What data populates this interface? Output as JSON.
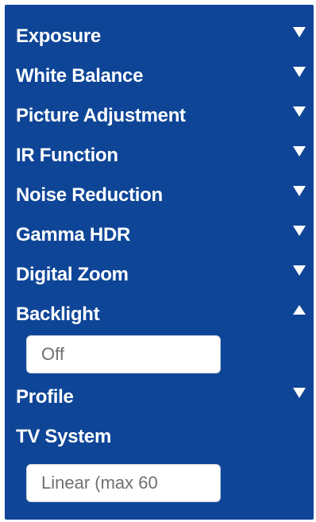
{
  "menu": {
    "items": [
      {
        "label": "Exposure",
        "arrow": "triangle-down-icon"
      },
      {
        "label": "White Balance",
        "arrow": "triangle-down-icon"
      },
      {
        "label": "Picture Adjustment",
        "arrow": "triangle-down-icon"
      },
      {
        "label": "IR Function",
        "arrow": "triangle-down-icon"
      },
      {
        "label": "Noise Reduction",
        "arrow": "triangle-down-icon"
      },
      {
        "label": "Gamma HDR",
        "arrow": "triangle-down-icon"
      },
      {
        "label": "Digital Zoom",
        "arrow": "triangle-down-icon"
      },
      {
        "label": "Backlight",
        "arrow": "triangle-up-icon"
      },
      {
        "label": "Profile",
        "arrow": "triangle-down-icon"
      },
      {
        "label": "TV System"
      }
    ]
  },
  "backlight": {
    "value": "Off"
  },
  "tv_system": {
    "value": "Linear (max 60"
  },
  "colors": {
    "panel_bg": "#0e4597",
    "text": "#ffffff",
    "field_bg": "#ffffff",
    "field_text": "#707070"
  }
}
